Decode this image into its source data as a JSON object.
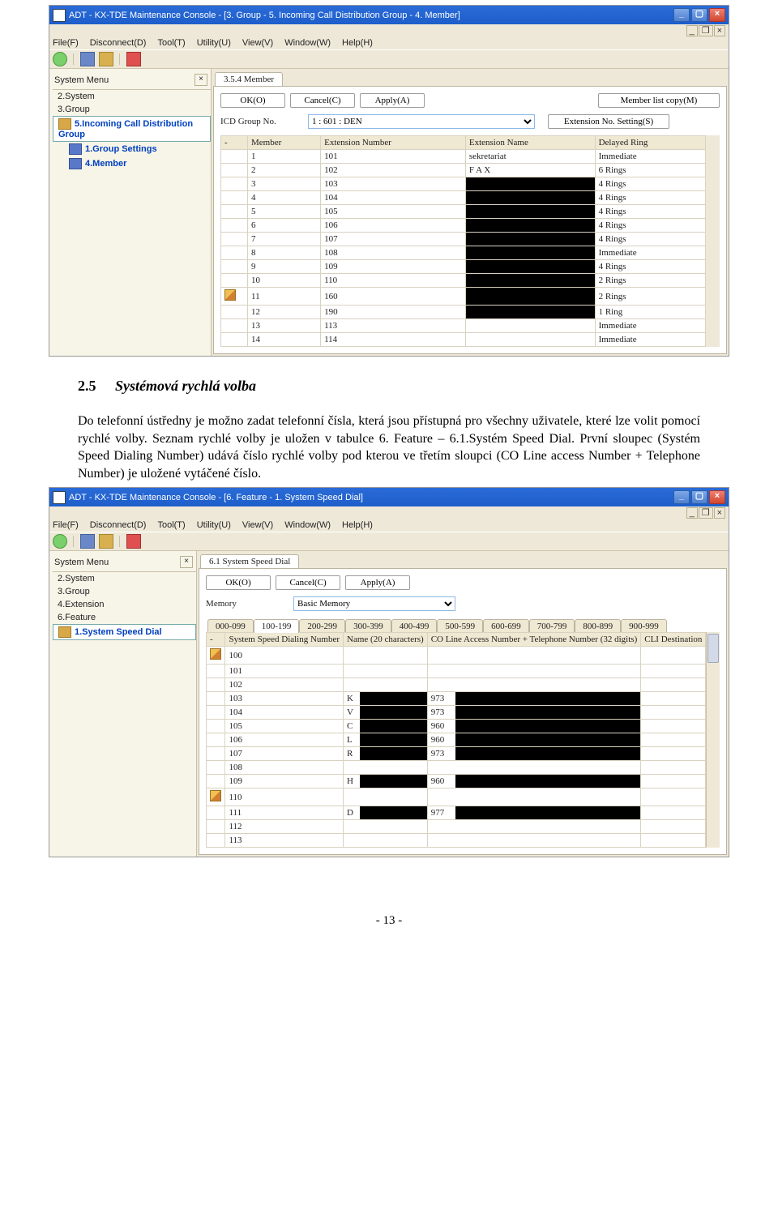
{
  "shot1": {
    "title": "ADT - KX-TDE Maintenance Console - [3. Group - 5. Incoming Call Distribution Group - 4. Member]",
    "menus": [
      "File(F)",
      "Disconnect(D)",
      "Tool(T)",
      "Utility(U)",
      "View(V)",
      "Window(W)",
      "Help(H)"
    ],
    "tree_head": "System Menu",
    "tree": [
      {
        "label": "2.System",
        "bold": false,
        "icon": ""
      },
      {
        "label": "3.Group",
        "bold": false,
        "icon": ""
      },
      {
        "label": "5.Incoming Call Distribution Group",
        "bold": true,
        "icon": "menu",
        "sel": true
      },
      {
        "label": "1.Group Settings",
        "bold": true,
        "icon": "group",
        "indent": 1
      },
      {
        "label": "4.Member",
        "bold": true,
        "icon": "group",
        "indent": 1
      }
    ],
    "tab": "3.5.4 Member",
    "buttons": {
      "ok": "OK(O)",
      "cancel": "Cancel(C)",
      "apply": "Apply(A)",
      "mlc": "Member list copy(M)",
      "ens": "Extension No. Setting(S)"
    },
    "fld_label": "ICD Group No.",
    "fld_value": "1 : 601 : DEN",
    "cols": [
      "Member",
      "Extension Number",
      "Extension Name",
      "Delayed Ring"
    ],
    "rows": [
      {
        "n": "1",
        "ext": "101",
        "name": "sekretariat",
        "ring": "Immediate"
      },
      {
        "n": "2",
        "ext": "102",
        "name": "F A X",
        "ring": "6 Rings"
      },
      {
        "n": "3",
        "ext": "103",
        "name": "",
        "ring": "4 Rings",
        "blk": true
      },
      {
        "n": "4",
        "ext": "104",
        "name": "",
        "ring": "4 Rings",
        "blk": true
      },
      {
        "n": "5",
        "ext": "105",
        "name": "",
        "ring": "4 Rings",
        "blk": true
      },
      {
        "n": "6",
        "ext": "106",
        "name": "",
        "ring": "4 Rings",
        "blk": true
      },
      {
        "n": "7",
        "ext": "107",
        "name": "",
        "ring": "4 Rings",
        "blk": true
      },
      {
        "n": "8",
        "ext": "108",
        "name": "",
        "ring": "Immediate",
        "blk": true
      },
      {
        "n": "9",
        "ext": "109",
        "name": "",
        "ring": "4 Rings",
        "blk": true
      },
      {
        "n": "10",
        "ext": "110",
        "name": "",
        "ring": "2 Rings",
        "blk": true
      },
      {
        "n": "11",
        "ext": "160",
        "name": "",
        "ring": "2 Rings",
        "blk": true,
        "pencil": true
      },
      {
        "n": "12",
        "ext": "190",
        "name": "",
        "ring": "1 Ring",
        "blk": true
      },
      {
        "n": "13",
        "ext": "113",
        "name": "",
        "ring": "Immediate"
      },
      {
        "n": "14",
        "ext": "114",
        "name": "",
        "ring": "Immediate"
      }
    ]
  },
  "section": {
    "num": "2.5",
    "title": "Systémová rychlá volba"
  },
  "para": "Do telefonní ústředny je možno zadat telefonní čísla, která jsou přístupná pro všechny uživatele, které lze volit pomocí rychlé volby. Seznam rychlé volby je uložen v tabulce 6. Feature – 6.1.Systém Speed Dial. První sloupec (Systém Speed Dialing Number) udává číslo rychlé volby pod kterou ve třetím sloupci (CO Line access Number + Telephone Number) je uložené vytáčené číslo.",
  "shot2": {
    "title": "ADT - KX-TDE Maintenance Console - [6. Feature - 1. System Speed Dial]",
    "menus": [
      "File(F)",
      "Disconnect(D)",
      "Tool(T)",
      "Utility(U)",
      "View(V)",
      "Window(W)",
      "Help(H)"
    ],
    "tree_head": "System Menu",
    "tree": [
      {
        "label": "2.System"
      },
      {
        "label": "3.Group"
      },
      {
        "label": "4.Extension"
      },
      {
        "label": "6.Feature"
      },
      {
        "label": "1.System Speed Dial",
        "bold": true,
        "icon": "menu",
        "sel": true,
        "indent": 0
      }
    ],
    "tab": "6.1 System Speed Dial",
    "buttons": {
      "ok": "OK(O)",
      "cancel": "Cancel(C)",
      "apply": "Apply(A)"
    },
    "fld_label": "Memory",
    "fld_value": "Basic Memory",
    "ranges": [
      "000-099",
      "100-199",
      "200-299",
      "300-399",
      "400-499",
      "500-599",
      "600-699",
      "700-799",
      "800-899",
      "900-999"
    ],
    "range_sel": 1,
    "cols": [
      "System Speed Dialing Number",
      "Name (20 characters)",
      "CO Line Access Number + Telephone Number (32 digits)",
      "CLI Destination"
    ],
    "rows": [
      {
        "n": "100",
        "nm": "",
        "co": "",
        "pencil": true
      },
      {
        "n": "101",
        "nm": "",
        "co": ""
      },
      {
        "n": "102",
        "nm": "",
        "co": ""
      },
      {
        "n": "103",
        "nm": "K",
        "co": "973",
        "blk": true
      },
      {
        "n": "104",
        "nm": "V",
        "co": "973",
        "blk": true
      },
      {
        "n": "105",
        "nm": "C",
        "co": "960",
        "blk": true
      },
      {
        "n": "106",
        "nm": "L",
        "co": "960",
        "blk": true
      },
      {
        "n": "107",
        "nm": "R",
        "co": "973",
        "blk": true
      },
      {
        "n": "108",
        "nm": "",
        "co": ""
      },
      {
        "n": "109",
        "nm": "H",
        "co": "960",
        "blk": true
      },
      {
        "n": "110",
        "nm": "",
        "co": "",
        "pencil": true
      },
      {
        "n": "111",
        "nm": "D",
        "co": "977",
        "blk": true
      },
      {
        "n": "112",
        "nm": "",
        "co": ""
      },
      {
        "n": "113",
        "nm": "",
        "co": ""
      }
    ]
  },
  "footer": "- 13 -"
}
